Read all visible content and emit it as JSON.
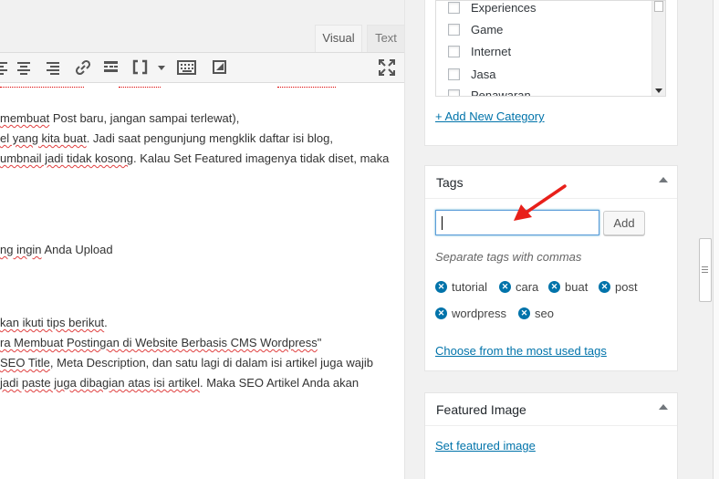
{
  "editor": {
    "tabs": {
      "visual": "Visual",
      "text": "Text"
    },
    "content_lines": [
      {
        "pre": "",
        "sq": "membuat",
        "post": " Post baru, jangan sampai terlewat),"
      },
      {
        "pre": "",
        "sq": "el yang kita buat",
        "post": ". Jadi saat pengunjung mengklik daftar isi blog,"
      },
      {
        "pre": "",
        "sq": "umbnail jadi tidak kosong",
        "post": ". Kalau Set Featured imagenya tidak diset, maka"
      },
      {
        "pre": "",
        "sq": "ng ingin",
        "post": " Anda Upload"
      },
      {
        "pre": "",
        "sq": "kan ikuti tips berikut",
        "post": "."
      },
      {
        "pre": "",
        "sq": "ra Membuat Postingan di Website Berbasis CMS Wordpress",
        "post": "\""
      },
      {
        "pre": "",
        "sq": "SEO Title",
        "post": ", Meta Description, dan satu lagi di dalam isi artikel juga wajib"
      },
      {
        "pre": " ",
        "sq": "jadi paste juga dibagian atas isi artikel",
        "post": ". Maka SEO Artikel Anda akan"
      }
    ]
  },
  "categories": {
    "items": [
      "Experiences",
      "Game",
      "Internet",
      "Jasa",
      "Penawaran"
    ],
    "add_new": "+ Add New Category"
  },
  "tags": {
    "title": "Tags",
    "input_value": "",
    "add_button": "Add",
    "hint": "Separate tags with commas",
    "list": [
      "tutorial",
      "cara",
      "buat",
      "post",
      "wordpress",
      "seo"
    ],
    "most_used_link": "Choose from the most used tags"
  },
  "featured_image": {
    "title": "Featured Image",
    "link": "Set featured image"
  },
  "colors": {
    "accent": "#0073aa",
    "arrow": "#e8201a"
  }
}
